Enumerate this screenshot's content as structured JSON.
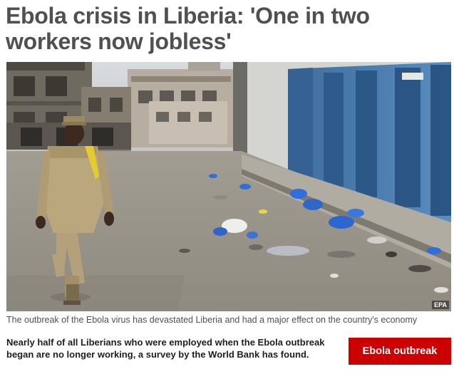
{
  "article": {
    "headline": "Ebola crisis in Liberia: 'One in two workers now jobless'",
    "caption": "The outbreak of the Ebola virus has devastated Liberia and had a major effect on the country's economy",
    "photo_credit": "EPA",
    "summary": "Nearly half of all Liberians who were employed when the Ebola outbreak began are no longer working, a survey by the World Bank has found."
  },
  "topic_button": {
    "label": "Ebola outbreak",
    "color": "#cc0000"
  }
}
